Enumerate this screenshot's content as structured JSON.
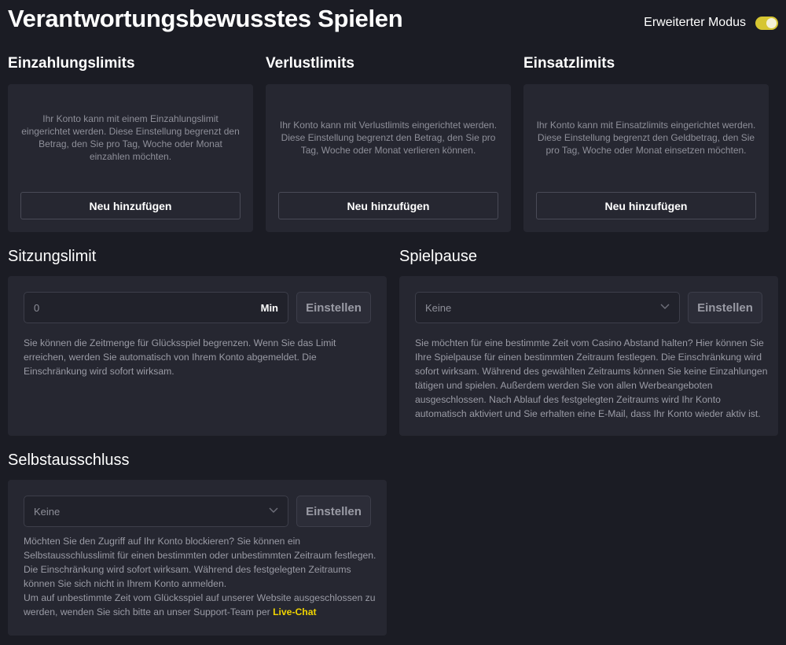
{
  "page": {
    "title": "Verantwortungsbewusstes Spielen",
    "advanced_mode_label": "Erweiterter Modus",
    "advanced_mode_on": true
  },
  "limits": [
    {
      "title": "Einzahlungslimits",
      "text": "Ihr Konto kann mit einem Einzahlungslimit eingerichtet werden. Diese Einstellung begrenzt den Betrag, den Sie pro Tag, Woche oder Monat einzahlen möchten.",
      "button": "Neu hinzufügen"
    },
    {
      "title": "Verlustlimits",
      "text": "Ihr Konto kann mit Verlustlimits eingerichtet werden. Diese Einstellung begrenzt den Betrag, den Sie pro Tag, Woche oder Monat verlieren können.",
      "button": "Neu hinzufügen"
    },
    {
      "title": "Einsatzlimits",
      "text": "Ihr Konto kann mit Einsatzlimits eingerichtet werden. Diese Einstellung begrenzt den Geldbetrag, den Sie pro Tag, Woche oder Monat einsetzen möchten.",
      "button": "Neu hinzufügen"
    }
  ],
  "session_limit": {
    "title": "Sitzungslimit",
    "input_value": "0",
    "unit": "Min",
    "button": "Einstellen",
    "text": "Sie können die Zeitmenge für Glücksspiel begrenzen. Wenn Sie das Limit erreichen, werden Sie automatisch von Ihrem Konto abgemeldet. Die Einschränkung wird sofort wirksam."
  },
  "game_pause": {
    "title": "Spielpause",
    "select_value": "Keine",
    "button": "Einstellen",
    "text": "Sie möchten für eine bestimmte Zeit vom Casino Abstand halten? Hier können Sie Ihre Spielpause für einen bestimmten Zeitraum festlegen. Die Einschränkung wird sofort wirksam. Während des gewählten Zeitraums können Sie keine Einzahlungen tätigen und spielen. Außerdem werden Sie von allen Werbeangeboten ausgeschlossen. Nach Ablauf des festgelegten Zeitraums wird Ihr Konto automatisch aktiviert und Sie erhalten eine E-Mail, dass Ihr Konto wieder aktiv ist."
  },
  "self_exclusion": {
    "title": "Selbstausschluss",
    "select_value": "Keine",
    "button": "Einstellen",
    "text": "Möchten Sie den Zugriff auf Ihr Konto blockieren? Sie können ein Selbstausschlusslimit für einen bestimmten oder unbestimmten Zeitraum festlegen. Die Einschränkung wird sofort wirksam. Während des festgelegten Zeitraums können Sie sich nicht in Ihrem Konto anmelden.",
    "text2": "Um auf unbestimmte Zeit vom Glücksspiel auf unserer Website ausgeschlossen zu werden, wenden Sie sich bitte an unser Support-Team per",
    "link": "Live-Chat"
  },
  "colors": {
    "background": "#1b1c24",
    "card": "#262731",
    "accent": "#f1d400",
    "toggle": "#d6c632"
  },
  "icons": {
    "select_arrow": "chevron-down-icon"
  }
}
